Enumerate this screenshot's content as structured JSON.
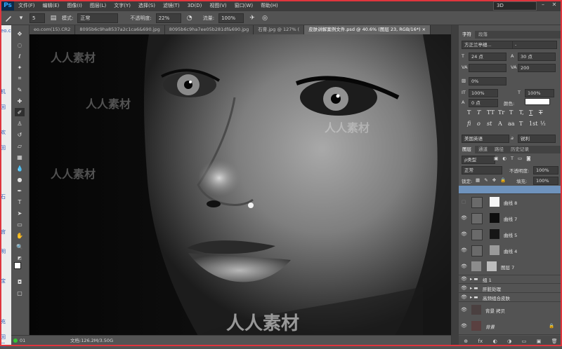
{
  "app": {
    "logo": "Ps"
  },
  "menu": [
    "文件(F)",
    "编辑(E)",
    "图像(I)",
    "图层(L)",
    "文字(Y)",
    "选择(S)",
    "滤镜(T)",
    "3D(D)",
    "视图(V)",
    "窗口(W)",
    "帮助(H)"
  ],
  "workspace": "3D",
  "window_controls": {
    "minimize": "–",
    "close": "✕"
  },
  "options": {
    "brush_size": "5",
    "mode_label": "模式:",
    "mode_value": "正常",
    "opacity_label": "不透明度:",
    "opacity_value": "22%",
    "flow_label": "流量:",
    "flow_value": "100%"
  },
  "left_strip": [
    "eo.com(15).CR2",
    "机",
    "回",
    "欢",
    "回",
    "石",
    "宫",
    "明",
    "宝",
    "充",
    "回",
    "元"
  ],
  "tabs": [
    {
      "label": "eo.com(15).CR2"
    },
    {
      "label": "8095b6c9ha8537a2c1ca6&690.jpg"
    },
    {
      "label": "8095b6c9ha7ee05b281df&690.jpg"
    },
    {
      "label": "石膏.jpg @ 127% ("
    },
    {
      "label": "皮肤讲解案例文件.psd @ 40.6% (图层 23, RGB/16*) ×",
      "active": true
    }
  ],
  "status": {
    "zoom": "01",
    "doc": "文档:126.2M/3.50G"
  },
  "character_panel": {
    "tabs": [
      "字符",
      "段落"
    ],
    "font_family": "方正兰亭细...",
    "font_style": "-",
    "font_size": "24 点",
    "leading": "30 点",
    "kerning": "",
    "tracking": "200",
    "scale_percent": "0%",
    "vertical_scale": "100%",
    "horizontal_scale": "100%",
    "baseline": "0 点",
    "color_label": "颜色:",
    "type_styles": [
      "T",
      "T",
      "TT",
      "Tr",
      "T",
      "T,",
      "T",
      "T"
    ],
    "opentype": [
      "fi",
      "o",
      "st",
      "A",
      "aa",
      "T",
      "1st",
      "½"
    ],
    "language": "美国英语",
    "aa_label": "a",
    "aa": "锐利"
  },
  "layers_panel": {
    "tabs": [
      "图层",
      "通道",
      "路径",
      "历史记录"
    ],
    "filter": "ρ类型",
    "blend_mode": "正常",
    "opacity_label": "不透明度:",
    "opacity_value": "100%",
    "lock_label": "锁定:",
    "fill_label": "填充:",
    "fill_value": "100%",
    "layers": [
      {
        "name": "曲线 8",
        "thumb": "#f5f5f5",
        "visible": false
      },
      {
        "name": "曲线 7",
        "thumb": "#0e0e0e",
        "visible": true
      },
      {
        "name": "曲线 5",
        "thumb": "#161616",
        "visible": true
      },
      {
        "name": "曲线 4",
        "thumb": "#9a9a9a",
        "visible": true
      },
      {
        "name": "图层 7",
        "thumb": "#bdbdbd",
        "visible": true
      }
    ],
    "groups": [
      "组 1",
      "肝脏处理",
      "高频组合皮肤"
    ],
    "bottom_layers": [
      {
        "name": "背景 拷贝",
        "thumb": "#4a4040"
      },
      {
        "name": "背景",
        "thumb": "#5a4040"
      }
    ],
    "bottom_icons": [
      "⊕",
      "fx",
      "◐",
      "◑",
      "▭",
      "▣",
      "🗑"
    ]
  },
  "watermarks": [
    "人人素材",
    "人人素材",
    "人人素材",
    "人人素材",
    "人人素材"
  ]
}
